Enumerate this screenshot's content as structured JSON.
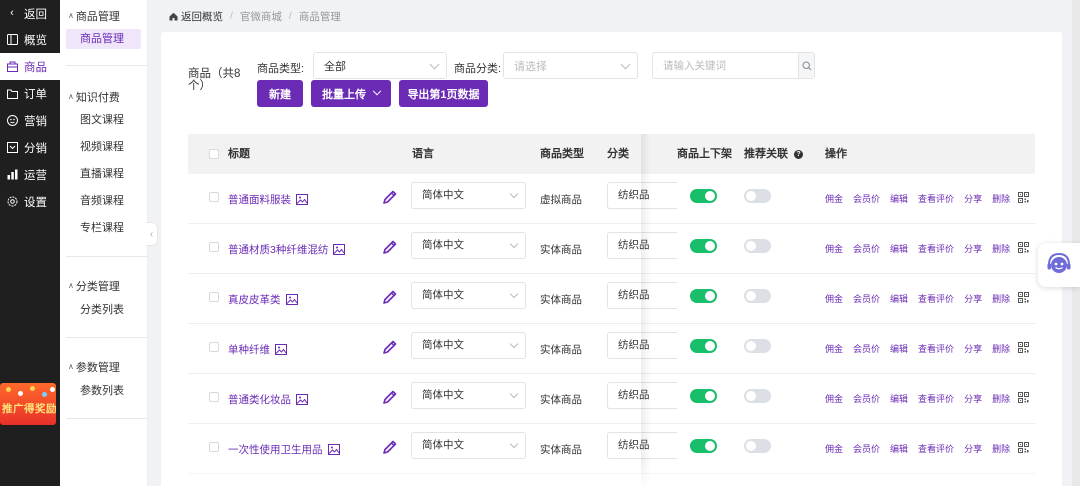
{
  "nav": {
    "back": "返回",
    "items": [
      {
        "label": "概览",
        "icon": "overview-icon"
      },
      {
        "label": "商品",
        "icon": "goods-icon"
      },
      {
        "label": "订单",
        "icon": "order-icon"
      },
      {
        "label": "营销",
        "icon": "marketing-icon"
      },
      {
        "label": "分销",
        "icon": "distribution-icon"
      },
      {
        "label": "运营",
        "icon": "operation-icon"
      },
      {
        "label": "设置",
        "icon": "settings-icon"
      }
    ],
    "promo": "推广得奖励"
  },
  "submenu": {
    "groups": [
      {
        "title": "商品管理",
        "items": [
          "商品管理"
        ]
      },
      {
        "title": "知识付费",
        "items": [
          "图文课程",
          "视频课程",
          "直播课程",
          "音频课程",
          "专栏课程"
        ]
      },
      {
        "title": "分类管理",
        "items": [
          "分类列表"
        ]
      },
      {
        "title": "参数管理",
        "items": [
          "参数列表"
        ]
      }
    ]
  },
  "breadcrumb": [
    "返回概览",
    "官微商城",
    "商品管理"
  ],
  "filter": {
    "title": "商品（共8个）",
    "type_label": "商品类型:",
    "type_value": "全部",
    "category_label": "商品分类:",
    "category_placeholder": "请选择",
    "search_placeholder": "请输入关键词"
  },
  "buttons": {
    "create": "新建",
    "batch_upload": "批量上传",
    "export": "导出第1页数据"
  },
  "table": {
    "headers": {
      "title": "标题",
      "language": "语言",
      "type": "商品类型",
      "category": "分类",
      "on_shelf": "商品上下架",
      "recommend": "推荐关联",
      "actions": "操作"
    },
    "actions": [
      "佣金",
      "会员价",
      "编辑",
      "查看评价",
      "分享",
      "删除"
    ],
    "rows": [
      {
        "title": "普通面料服装",
        "language": "简体中文",
        "type": "虚拟商品",
        "category": "纺织品",
        "on_shelf": true,
        "recommend": false
      },
      {
        "title": "普通材质3种纤维混纺",
        "language": "简体中文",
        "type": "实体商品",
        "category": "纺织品",
        "on_shelf": true,
        "recommend": false
      },
      {
        "title": "真皮皮革类",
        "language": "简体中文",
        "type": "实体商品",
        "category": "纺织品",
        "on_shelf": true,
        "recommend": false
      },
      {
        "title": "单种纤维",
        "language": "简体中文",
        "type": "实体商品",
        "category": "纺织品",
        "on_shelf": true,
        "recommend": false
      },
      {
        "title": "普通类化妆品",
        "language": "简体中文",
        "type": "实体商品",
        "category": "纺织品",
        "on_shelf": true,
        "recommend": false
      },
      {
        "title": "一次性使用卫生用品",
        "language": "简体中文",
        "type": "实体商品",
        "category": "纺织品",
        "on_shelf": true,
        "recommend": false
      }
    ]
  },
  "colors": {
    "accent": "#6b2bb5",
    "toggle_on": "#19be6b",
    "nav_bg": "#1f1f1f"
  }
}
